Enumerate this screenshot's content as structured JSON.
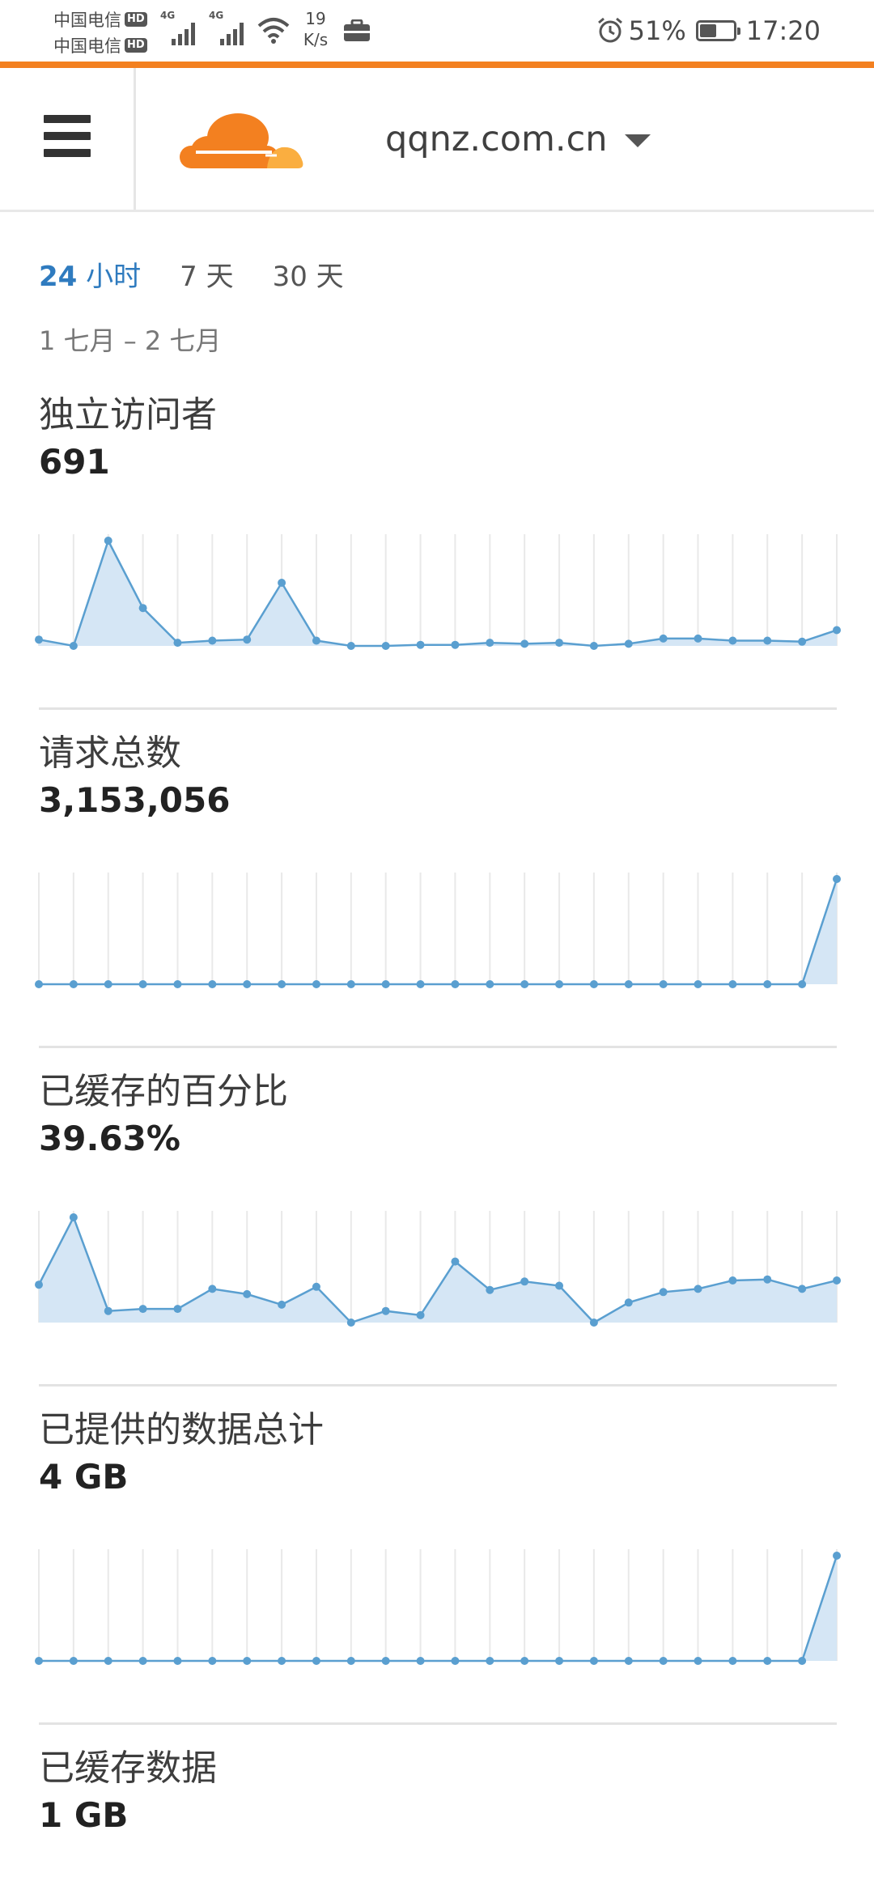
{
  "status_bar": {
    "carrier_1": "中国电信",
    "carrier_2": "中国电信",
    "hd_badge": "HD",
    "network_type_1": "4G",
    "network_type_2": "4G",
    "net_speed_value": "19",
    "net_speed_unit": "K/s",
    "battery_percent": "51%",
    "battery_level": 0.51,
    "time": "17:20",
    "icons": [
      "signal-icon",
      "wifi-icon",
      "briefcase-icon",
      "alarm-icon",
      "battery-icon"
    ]
  },
  "header": {
    "menu_icon": "hamburger-menu-icon",
    "logo": "cloudflare-logo",
    "domain": "qqnz.com.cn",
    "dropdown_icon": "caret-down-icon"
  },
  "time_range": {
    "tabs": [
      {
        "num": "24",
        "unit": "小时",
        "active": true
      },
      {
        "num": "7",
        "unit": "天",
        "active": false
      },
      {
        "num": "30",
        "unit": "天",
        "active": false
      }
    ],
    "date_range": "1 七月 – 2 七月"
  },
  "colors": {
    "accent": "#f38020",
    "active_tab": "#2f7bbf",
    "chart_line": "#5a9fd0",
    "chart_fill": "#d5e6f5"
  },
  "metrics": [
    {
      "label": "独立访问者",
      "value": "691"
    },
    {
      "label": "请求总数",
      "value": "3,153,056"
    },
    {
      "label": "已缓存的百分比",
      "value": "39.63%"
    },
    {
      "label": "已提供的数据总计",
      "value": "4 GB"
    },
    {
      "label": "已缓存数据",
      "value": "1 GB"
    }
  ],
  "chart_data": [
    {
      "type": "area",
      "series": [
        {
          "values": [
            6,
            0,
            100,
            36,
            3,
            5,
            6,
            60,
            5,
            0,
            0,
            1,
            1,
            3,
            2,
            3,
            0,
            2,
            7,
            7,
            5,
            5,
            4,
            15
          ]
        }
      ],
      "ylim": [
        0,
        100
      ],
      "grid": "vertical"
    },
    {
      "type": "area",
      "series": [
        {
          "values": [
            0,
            0,
            0,
            0,
            0,
            0,
            0,
            0,
            0,
            0,
            0,
            0,
            0,
            0,
            0,
            0,
            0,
            0,
            0,
            0,
            0,
            0,
            0,
            100
          ]
        }
      ],
      "ylim": [
        0,
        100
      ],
      "grid": "vertical"
    },
    {
      "type": "area",
      "series": [
        {
          "values": [
            36,
            100,
            11,
            13,
            13,
            32,
            27,
            17,
            34,
            0,
            11,
            7,
            58,
            31,
            39,
            35,
            0,
            19,
            29,
            32,
            40,
            41,
            32,
            40
          ]
        }
      ],
      "ylim": [
        0,
        100
      ],
      "grid": "vertical"
    },
    {
      "type": "area",
      "series": [
        {
          "values": [
            0,
            0,
            0,
            0,
            0,
            0,
            0,
            0,
            0,
            0,
            0,
            0,
            0,
            0,
            0,
            0,
            0,
            0,
            0,
            0,
            0,
            0,
            0,
            100
          ]
        }
      ],
      "ylim": [
        0,
        100
      ],
      "grid": "vertical"
    }
  ]
}
